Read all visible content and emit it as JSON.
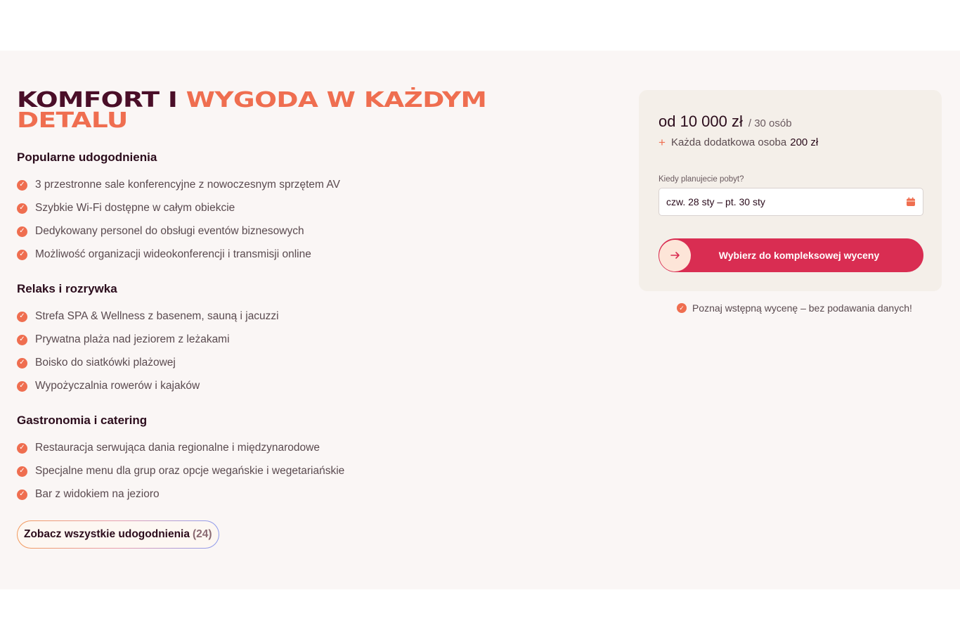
{
  "headline": {
    "part_dark": "KOMFORT I",
    "part_accent_1": "WYGODA W KAŻDYM",
    "part_accent_2": "DETALU"
  },
  "groups": [
    {
      "title": "Popularne udogodnienia",
      "items": [
        "3 przestronne sale konferencyjne z nowoczesnym sprzętem AV",
        "Szybkie Wi-Fi dostępne w całym obiekcie",
        "Dedykowany personel do obsługi eventów biznesowych",
        "Możliwość organizacji wideokonferencji i transmisji online"
      ]
    },
    {
      "title": "Relaks i rozrywka",
      "items": [
        "Strefa SPA & Wellness z basenem, sauną i jacuzzi",
        "Prywatna plaża nad jeziorem z leżakami",
        "Boisko do siatkówki plażowej",
        "Wypożyczalnia rowerów i kajaków"
      ]
    },
    {
      "title": "Gastronomia i catering",
      "items": [
        "Restauracja serwująca dania regionalne i międzynarodowe",
        "Specjalne menu dla grup oraz opcje wegańskie i wegetariańskie",
        "Bar z widokiem na jezioro"
      ]
    }
  ],
  "show_all": {
    "label": "Zobacz wszystkie udogodnienia",
    "count": "(24)"
  },
  "booking": {
    "price": "od 10 000 zł",
    "per": "/ 30 osób",
    "extra_label": "Każda dodatkowa osoba",
    "extra_value": "200 zł",
    "date_label": "Kiedy planujecie pobyt?",
    "date_value": "czw. 28 sty – pt. 30 sty",
    "cta_label": "Wybierz do kompleksowej wyceny",
    "note": "Poznaj wstępną wycenę – bez podawania danych!"
  },
  "icons": {
    "check": "check-circle-icon",
    "calendar": "calendar-icon",
    "arrow": "arrow-right-icon",
    "plus": "plus-icon"
  },
  "colors": {
    "accent": "#ef6e50",
    "dark": "#4a0e28",
    "cta": "#d92d52",
    "background": "#faf6f5",
    "card": "#f4efe9"
  }
}
